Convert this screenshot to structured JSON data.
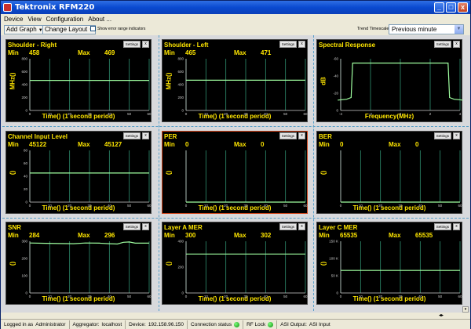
{
  "window": {
    "title": "Tektronix RFM220",
    "buttons": {
      "minimize": "_",
      "maximize": "□",
      "close": "x"
    }
  },
  "menu": [
    "Device",
    "View",
    "Configuration",
    "About ..."
  ],
  "toolbar": {
    "add_graph": "Add Graph",
    "change_layout": "Change Layout",
    "show_error_ranges": "Show error range indicators",
    "trend_timescale_label": "Trend Timescale:",
    "trend_timescale_value": "Previous minute"
  },
  "panel_buttons": {
    "settings": "Settings",
    "close": "x"
  },
  "colors": {
    "trace": "#9fffa0",
    "grid": "#2f8f6f",
    "accent": "#ffe600",
    "axis": "#cfcfcf"
  },
  "panels": [
    {
      "title": "Shoulder - Right",
      "min_label": "Min",
      "min": "458",
      "max_label": "Max",
      "max": "469",
      "ylabel": "MHz()",
      "xlabel": "Time() (1 second period)"
    },
    {
      "title": "Shoulder - Left",
      "min_label": "Min",
      "min": "465",
      "max_label": "Max",
      "max": "471",
      "ylabel": "MHz()",
      "xlabel": "Time() (1 second period)"
    },
    {
      "title": "Spectral Response",
      "min_label": "",
      "min": "",
      "max_label": "",
      "max": "",
      "ylabel": "dB",
      "xlabel": "Frequency(MHz)"
    },
    {
      "title": "Channel Input Level",
      "min_label": "Min",
      "min": "45122",
      "max_label": "Max",
      "max": "45127",
      "ylabel": "()",
      "xlabel": "Time() (1 second period)"
    },
    {
      "title": "PER",
      "min_label": "Min",
      "min": "0",
      "max_label": "Max",
      "max": "0",
      "ylabel": "()",
      "xlabel": "Time() (1 second period)"
    },
    {
      "title": "BER",
      "min_label": "Min",
      "min": "0",
      "max_label": "Max",
      "max": "0",
      "ylabel": "()",
      "xlabel": "Time() (1 second period)"
    },
    {
      "title": "SNR",
      "min_label": "Min",
      "min": "284",
      "max_label": "Max",
      "max": "296",
      "ylabel": "()",
      "xlabel": "Time() (1 second period)"
    },
    {
      "title": "Layer A MER",
      "min_label": "Min",
      "min": "300",
      "max_label": "Max",
      "max": "302",
      "ylabel": "()",
      "xlabel": "Time() (1 second period)"
    },
    {
      "title": "Layer C MER",
      "min_label": "Min",
      "min": "65535",
      "max_label": "Max",
      "max": "65535",
      "ylabel": "()",
      "xlabel": "Time() (1 second period)"
    }
  ],
  "chart_data": [
    {
      "type": "line",
      "title": "Shoulder - Right",
      "xlabel": "Time() (1 second period)",
      "ylabel": "MHz()",
      "xlim": [
        0,
        60
      ],
      "ylim": [
        0,
        800
      ],
      "x_ticks": [
        "0",
        "10",
        "20",
        "30",
        "40",
        "50",
        "60"
      ],
      "y_ticks": [
        "0",
        "200",
        "400",
        "600",
        "800"
      ],
      "series": [
        {
          "x": [
            0,
            60
          ],
          "values": [
            465,
            465
          ]
        }
      ]
    },
    {
      "type": "line",
      "title": "Shoulder - Left",
      "xlabel": "Time() (1 second period)",
      "ylabel": "MHz()",
      "xlim": [
        0,
        60
      ],
      "ylim": [
        0,
        800
      ],
      "x_ticks": [
        "0",
        "10",
        "20",
        "30",
        "40",
        "50",
        "60"
      ],
      "y_ticks": [
        "0",
        "200",
        "400",
        "600",
        "800"
      ],
      "series": [
        {
          "x": [
            0,
            60
          ],
          "values": [
            468,
            468
          ]
        }
      ]
    },
    {
      "type": "line",
      "title": "Spectral Response",
      "xlabel": "Frequency(MHz)",
      "ylabel": "dB",
      "xlim": [
        -4,
        4
      ],
      "ylim": [
        -60,
        0
      ],
      "x_ticks": [
        "-4",
        "-2",
        "0",
        "2",
        "4"
      ],
      "y_ticks": [
        "0",
        "-20",
        "-40",
        "-60"
      ],
      "series": [
        {
          "x": [
            -4.2,
            -3.6,
            -3.3,
            -3.2,
            3.2,
            3.3,
            3.6,
            4.2
          ],
          "values": [
            -48,
            -47,
            -45,
            -5,
            -5,
            -45,
            -47,
            -48
          ]
        }
      ]
    },
    {
      "type": "line",
      "title": "Channel Input Level",
      "xlabel": "Time() (1 second period)",
      "ylabel": "()",
      "xlim": [
        0,
        60
      ],
      "ylim": [
        0,
        80
      ],
      "x_ticks": [
        "0",
        "10",
        "20",
        "30",
        "40",
        "50",
        "60"
      ],
      "y_ticks": [
        "0",
        "20",
        "40",
        "60",
        "80"
      ],
      "series": [
        {
          "x": [
            0,
            60
          ],
          "values": [
            45,
            45
          ]
        }
      ]
    },
    {
      "type": "line",
      "title": "PER",
      "xlabel": "Time() (1 second period)",
      "ylabel": "()",
      "xlim": [
        0,
        60
      ],
      "ylim": [
        0,
        1
      ],
      "x_ticks": [
        "0",
        "10",
        "20",
        "30",
        "40",
        "50",
        "60"
      ],
      "y_ticks": [],
      "series": [
        {
          "x": [
            0,
            60
          ],
          "values": [
            0,
            0
          ]
        }
      ]
    },
    {
      "type": "line",
      "title": "BER",
      "xlabel": "Time() (1 second period)",
      "ylabel": "()",
      "xlim": [
        0,
        60
      ],
      "ylim": [
        0,
        1
      ],
      "x_ticks": [
        "0",
        "10",
        "20",
        "30",
        "40",
        "50",
        "60"
      ],
      "y_ticks": [],
      "series": [
        {
          "x": [
            0,
            60
          ],
          "values": [
            0,
            0
          ]
        }
      ]
    },
    {
      "type": "line",
      "title": "SNR",
      "xlabel": "Time() (1 second period)",
      "ylabel": "()",
      "xlim": [
        0,
        60
      ],
      "ylim": [
        0,
        300
      ],
      "x_ticks": [
        "0",
        "10",
        "20",
        "30",
        "40",
        "50",
        "60"
      ],
      "y_ticks": [
        "0",
        "100",
        "200",
        "300"
      ],
      "series": [
        {
          "x": [
            0,
            8,
            15,
            22,
            28,
            35,
            40,
            44,
            47,
            50,
            53,
            56,
            60
          ],
          "values": [
            290,
            288,
            287,
            286,
            290,
            289,
            286,
            284,
            294,
            296,
            289,
            289,
            289
          ]
        }
      ]
    },
    {
      "type": "line",
      "title": "Layer A MER",
      "xlabel": "Time() (1 second period)",
      "ylabel": "()",
      "xlim": [
        0,
        60
      ],
      "ylim": [
        0,
        400
      ],
      "x_ticks": [
        "0",
        "10",
        "20",
        "30",
        "40",
        "50",
        "60"
      ],
      "y_ticks": [
        "0",
        "200",
        "400"
      ],
      "series": [
        {
          "x": [
            0,
            60
          ],
          "values": [
            301,
            301
          ]
        }
      ]
    },
    {
      "type": "line",
      "title": "Layer C MER",
      "xlabel": "Time() (1 second period)",
      "ylabel": "()",
      "xlim": [
        0,
        60
      ],
      "ylim": [
        0,
        150000
      ],
      "x_ticks": [
        "0",
        "10",
        "20",
        "30",
        "40",
        "50",
        "60"
      ],
      "y_ticks": [
        "0",
        "50 K",
        "100 K",
        "150 K"
      ],
      "series": [
        {
          "x": [
            0,
            60
          ],
          "values": [
            65535,
            65535
          ]
        }
      ]
    }
  ],
  "status": {
    "logged_in_label": "Logged in as",
    "logged_in_value": "Administrator",
    "aggregator_label": "Aggregator:",
    "aggregator_value": "localhost",
    "device_label": "Device:",
    "device_value": "192.158.96.150",
    "connection_label": "Connection status",
    "rf_lock": "RF Lock",
    "asi_output_label": "ASI Output:",
    "asi_output_value": "ASI Input"
  }
}
